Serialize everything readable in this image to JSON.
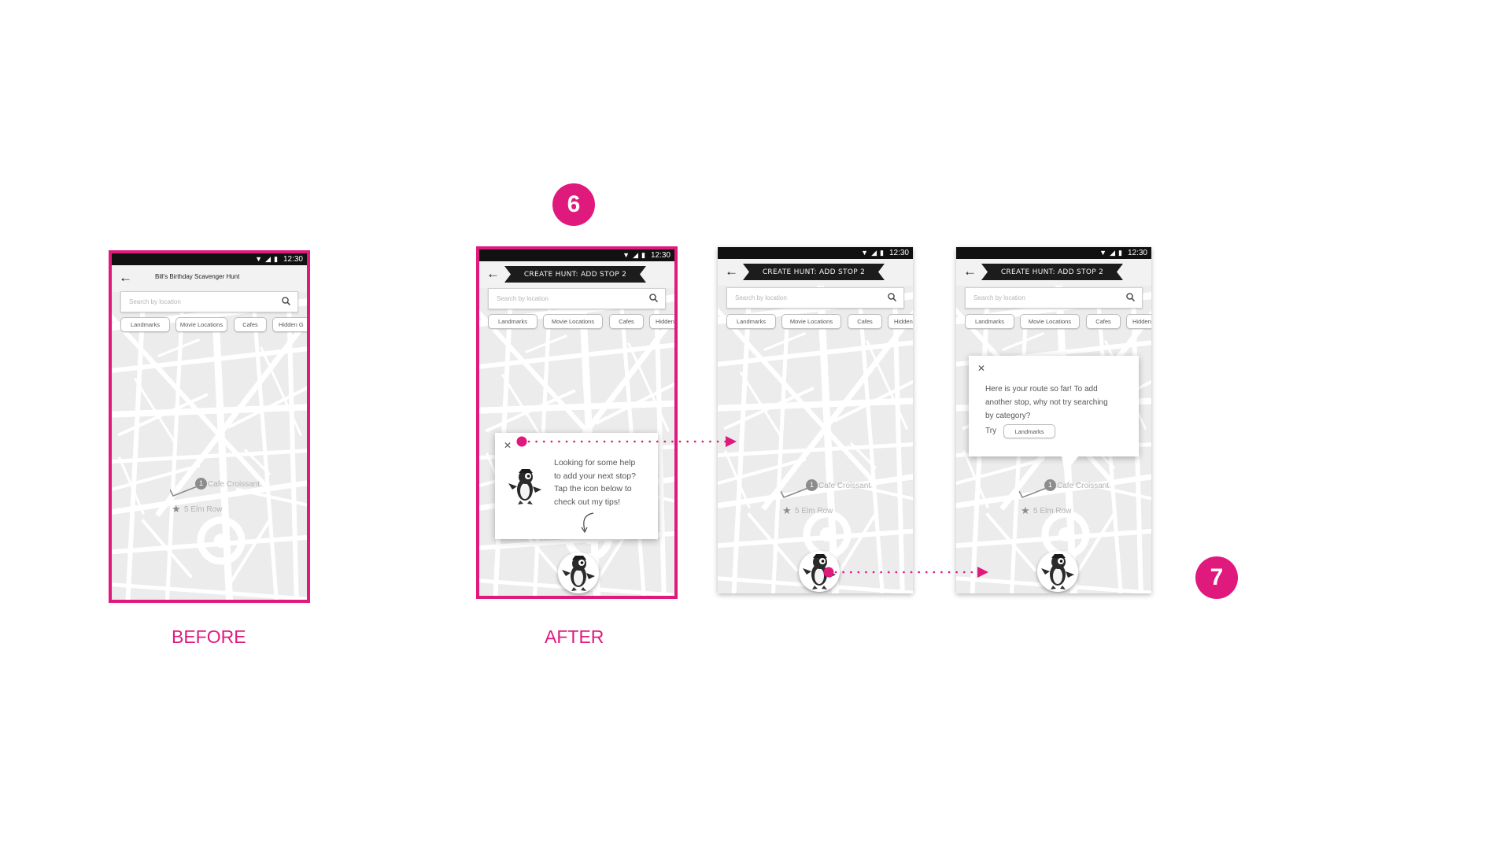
{
  "steps": {
    "step_a": "6",
    "step_b": "7"
  },
  "captions": {
    "before": "BEFORE",
    "after": "AFTER"
  },
  "status_bar": {
    "time": "12:30"
  },
  "before_screen": {
    "title": "Bill's Birthday Scavenger Hunt",
    "search_placeholder": "Search by location",
    "chips": [
      "Landmarks",
      "Movie Locations",
      "Cafes",
      "Hidden G"
    ],
    "pin_number": "1",
    "pin_label": "Cafe Croissant",
    "start_label": "5 Elm Row"
  },
  "after_screens": {
    "banner_title": "CREATE HUNT: ADD STOP 2",
    "search_placeholder": "Search by location",
    "chips": [
      "Landmarks",
      "Movie Locations",
      "Cafes",
      "Hidden"
    ],
    "pin_number": "1",
    "pin_label": "Cafe Croissant",
    "start_label": "5 Elm Row"
  },
  "help_card": {
    "text": "Looking for some help to add your next stop? Tap the icon below to check out my tips!",
    "lines": [
      "Looking for some help",
      "to add your next stop?",
      "Tap the icon below to",
      "check out my tips!"
    ]
  },
  "route_card": {
    "lines": [
      "Here is your route so far! To add",
      "another stop, why not try searching",
      "by category?"
    ],
    "try_label": "Try",
    "try_chip": "Landmarks"
  },
  "icons": {
    "back": "arrow-left-icon",
    "search": "search-icon",
    "close": "close-icon",
    "mascot": "mascot-icon",
    "star": "star-icon"
  },
  "colors": {
    "accent": "#e0197d",
    "map_bg": "#f0f0f0",
    "map_streets": "#ffffff",
    "status_bar": "#111111"
  }
}
